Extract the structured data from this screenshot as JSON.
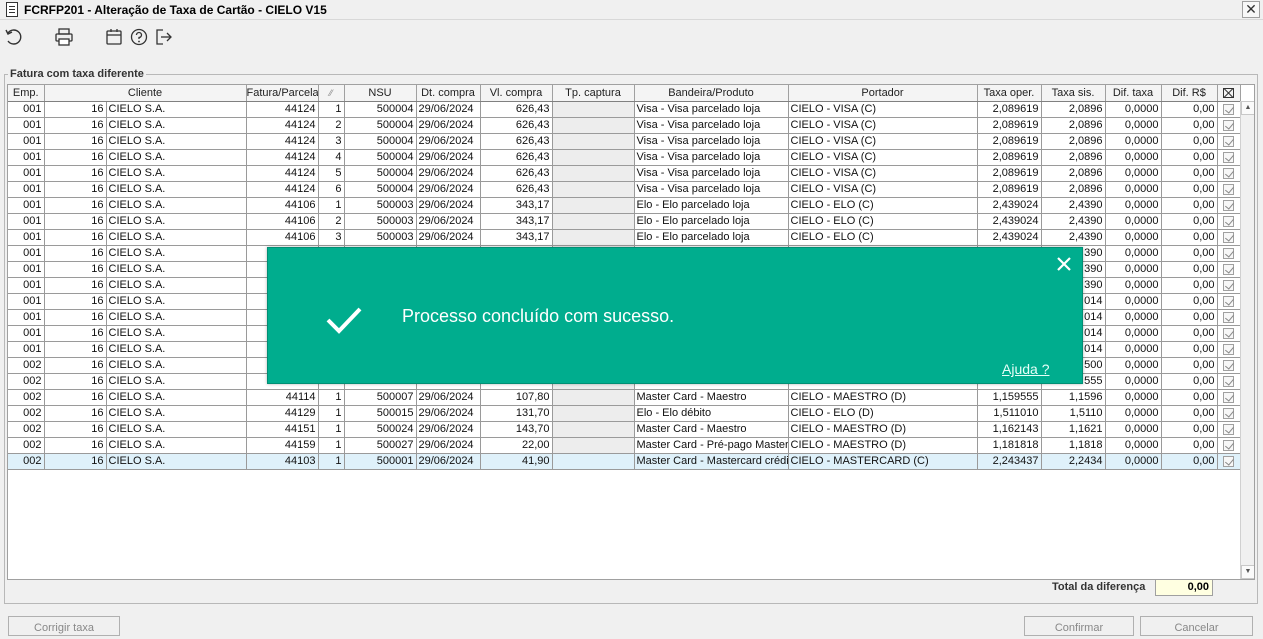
{
  "window": {
    "title": "FCRFP201 - Alteração de Taxa de Cartão - CIELO V15"
  },
  "toolbar": {
    "icons": [
      "refresh-icon",
      "printer-icon",
      "calendar-icon",
      "help-icon",
      "exit-icon"
    ]
  },
  "section": {
    "legend": "Fatura com taxa diferente"
  },
  "grid": {
    "columns": [
      "Emp.",
      "Cliente",
      "",
      "Fatura/Parcela",
      "",
      "NSU",
      "Dt. compra",
      "Vl. compra",
      "Tp. captura",
      "Bandeira/Produto",
      "Portador",
      "Taxa oper.",
      "Taxa sis.",
      "Dif. taxa",
      "Dif. R$",
      ""
    ],
    "rows": [
      {
        "emp": "001",
        "cod": "16",
        "cliente": "CIELO S.A.",
        "fatura": "44124",
        "parc": "1",
        "nsu": "500004",
        "dt": "29/06/2024",
        "vl": "626,43",
        "tp": "",
        "band": "Visa - Visa parcelado loja",
        "port": "CIELO - VISA (C)",
        "toper": "2,089619",
        "tsis": "2,0896",
        "dtaxa": "0,0000",
        "drs": "0,00"
      },
      {
        "emp": "001",
        "cod": "16",
        "cliente": "CIELO S.A.",
        "fatura": "44124",
        "parc": "2",
        "nsu": "500004",
        "dt": "29/06/2024",
        "vl": "626,43",
        "tp": "",
        "band": "Visa - Visa parcelado loja",
        "port": "CIELO - VISA (C)",
        "toper": "2,089619",
        "tsis": "2,0896",
        "dtaxa": "0,0000",
        "drs": "0,00"
      },
      {
        "emp": "001",
        "cod": "16",
        "cliente": "CIELO S.A.",
        "fatura": "44124",
        "parc": "3",
        "nsu": "500004",
        "dt": "29/06/2024",
        "vl": "626,43",
        "tp": "",
        "band": "Visa - Visa parcelado loja",
        "port": "CIELO - VISA (C)",
        "toper": "2,089619",
        "tsis": "2,0896",
        "dtaxa": "0,0000",
        "drs": "0,00"
      },
      {
        "emp": "001",
        "cod": "16",
        "cliente": "CIELO S.A.",
        "fatura": "44124",
        "parc": "4",
        "nsu": "500004",
        "dt": "29/06/2024",
        "vl": "626,43",
        "tp": "",
        "band": "Visa - Visa parcelado loja",
        "port": "CIELO - VISA (C)",
        "toper": "2,089619",
        "tsis": "2,0896",
        "dtaxa": "0,0000",
        "drs": "0,00"
      },
      {
        "emp": "001",
        "cod": "16",
        "cliente": "CIELO S.A.",
        "fatura": "44124",
        "parc": "5",
        "nsu": "500004",
        "dt": "29/06/2024",
        "vl": "626,43",
        "tp": "",
        "band": "Visa - Visa parcelado loja",
        "port": "CIELO - VISA (C)",
        "toper": "2,089619",
        "tsis": "2,0896",
        "dtaxa": "0,0000",
        "drs": "0,00"
      },
      {
        "emp": "001",
        "cod": "16",
        "cliente": "CIELO S.A.",
        "fatura": "44124",
        "parc": "6",
        "nsu": "500004",
        "dt": "29/06/2024",
        "vl": "626,43",
        "tp": "",
        "band": "Visa - Visa parcelado loja",
        "port": "CIELO - VISA (C)",
        "toper": "2,089619",
        "tsis": "2,0896",
        "dtaxa": "0,0000",
        "drs": "0,00"
      },
      {
        "emp": "001",
        "cod": "16",
        "cliente": "CIELO S.A.",
        "fatura": "44106",
        "parc": "1",
        "nsu": "500003",
        "dt": "29/06/2024",
        "vl": "343,17",
        "tp": "",
        "band": "Elo - Elo parcelado loja",
        "port": "CIELO - ELO (C)",
        "toper": "2,439024",
        "tsis": "2,4390",
        "dtaxa": "0,0000",
        "drs": "0,00"
      },
      {
        "emp": "001",
        "cod": "16",
        "cliente": "CIELO S.A.",
        "fatura": "44106",
        "parc": "2",
        "nsu": "500003",
        "dt": "29/06/2024",
        "vl": "343,17",
        "tp": "",
        "band": "Elo - Elo parcelado loja",
        "port": "CIELO - ELO (C)",
        "toper": "2,439024",
        "tsis": "2,4390",
        "dtaxa": "0,0000",
        "drs": "0,00"
      },
      {
        "emp": "001",
        "cod": "16",
        "cliente": "CIELO S.A.",
        "fatura": "44106",
        "parc": "3",
        "nsu": "500003",
        "dt": "29/06/2024",
        "vl": "343,17",
        "tp": "",
        "band": "Elo - Elo parcelado loja",
        "port": "CIELO - ELO (C)",
        "toper": "2,439024",
        "tsis": "2,4390",
        "dtaxa": "0,0000",
        "drs": "0,00"
      },
      {
        "emp": "001",
        "cod": "16",
        "cliente": "CIELO S.A.",
        "fatura": "",
        "parc": "",
        "nsu": "",
        "dt": "",
        "vl": "",
        "tp": "",
        "band": "",
        "port": "",
        "toper": "",
        "tsis": "390",
        "dtaxa": "0,0000",
        "drs": "0,00"
      },
      {
        "emp": "001",
        "cod": "16",
        "cliente": "CIELO S.A.",
        "fatura": "",
        "parc": "",
        "nsu": "",
        "dt": "",
        "vl": "",
        "tp": "",
        "band": "",
        "port": "",
        "toper": "",
        "tsis": "390",
        "dtaxa": "0,0000",
        "drs": "0,00"
      },
      {
        "emp": "001",
        "cod": "16",
        "cliente": "CIELO S.A.",
        "fatura": "",
        "parc": "",
        "nsu": "",
        "dt": "",
        "vl": "",
        "tp": "",
        "band": "",
        "port": "",
        "toper": "",
        "tsis": "390",
        "dtaxa": "0,0000",
        "drs": "0,00"
      },
      {
        "emp": "001",
        "cod": "16",
        "cliente": "CIELO S.A.",
        "fatura": "",
        "parc": "",
        "nsu": "",
        "dt": "",
        "vl": "",
        "tp": "",
        "band": "",
        "port": "",
        "toper": "",
        "tsis": "014",
        "dtaxa": "0,0000",
        "drs": "0,00"
      },
      {
        "emp": "001",
        "cod": "16",
        "cliente": "CIELO S.A.",
        "fatura": "",
        "parc": "",
        "nsu": "",
        "dt": "",
        "vl": "",
        "tp": "",
        "band": "",
        "port": "",
        "toper": "",
        "tsis": "014",
        "dtaxa": "0,0000",
        "drs": "0,00"
      },
      {
        "emp": "001",
        "cod": "16",
        "cliente": "CIELO S.A.",
        "fatura": "",
        "parc": "",
        "nsu": "",
        "dt": "",
        "vl": "",
        "tp": "",
        "band": "",
        "port": "",
        "toper": "",
        "tsis": "014",
        "dtaxa": "0,0000",
        "drs": "0,00"
      },
      {
        "emp": "001",
        "cod": "16",
        "cliente": "CIELO S.A.",
        "fatura": "",
        "parc": "",
        "nsu": "",
        "dt": "",
        "vl": "",
        "tp": "",
        "band": "",
        "port": "",
        "toper": "",
        "tsis": "014",
        "dtaxa": "0,0000",
        "drs": "0,00"
      },
      {
        "emp": "002",
        "cod": "16",
        "cliente": "CIELO S.A.",
        "fatura": "",
        "parc": "",
        "nsu": "",
        "dt": "",
        "vl": "",
        "tp": "",
        "band": "",
        "port": "",
        "toper": "",
        "tsis": "500",
        "dtaxa": "0,0000",
        "drs": "0,00"
      },
      {
        "emp": "002",
        "cod": "16",
        "cliente": "CIELO S.A.",
        "fatura": "",
        "parc": "",
        "nsu": "",
        "dt": "",
        "vl": "",
        "tp": "",
        "band": "",
        "port": "",
        "toper": "",
        "tsis": "555",
        "dtaxa": "0,0000",
        "drs": "0,00"
      },
      {
        "emp": "002",
        "cod": "16",
        "cliente": "CIELO S.A.",
        "fatura": "44114",
        "parc": "1",
        "nsu": "500007",
        "dt": "29/06/2024",
        "vl": "107,80",
        "tp": "",
        "band": "Master Card - Maestro",
        "port": "CIELO - MAESTRO (D)",
        "toper": "1,159555",
        "tsis": "1,1596",
        "dtaxa": "0,0000",
        "drs": "0,00"
      },
      {
        "emp": "002",
        "cod": "16",
        "cliente": "CIELO S.A.",
        "fatura": "44129",
        "parc": "1",
        "nsu": "500015",
        "dt": "29/06/2024",
        "vl": "131,70",
        "tp": "",
        "band": "Elo - Elo débito",
        "port": "CIELO - ELO (D)",
        "toper": "1,511010",
        "tsis": "1,5110",
        "dtaxa": "0,0000",
        "drs": "0,00"
      },
      {
        "emp": "002",
        "cod": "16",
        "cliente": "CIELO S.A.",
        "fatura": "44151",
        "parc": "1",
        "nsu": "500024",
        "dt": "29/06/2024",
        "vl": "143,70",
        "tp": "",
        "band": "Master Card - Maestro",
        "port": "CIELO - MAESTRO (D)",
        "toper": "1,162143",
        "tsis": "1,1621",
        "dtaxa": "0,0000",
        "drs": "0,00"
      },
      {
        "emp": "002",
        "cod": "16",
        "cliente": "CIELO S.A.",
        "fatura": "44159",
        "parc": "1",
        "nsu": "500027",
        "dt": "29/06/2024",
        "vl": "22,00",
        "tp": "",
        "band": "Master Card - Pré-pago Master",
        "port": "CIELO - MAESTRO (D)",
        "toper": "1,181818",
        "tsis": "1,1818",
        "dtaxa": "0,0000",
        "drs": "0,00"
      },
      {
        "emp": "002",
        "cod": "16",
        "cliente": "CIELO S.A.",
        "fatura": "44103",
        "parc": "1",
        "nsu": "500001",
        "dt": "29/06/2024",
        "vl": "41,90",
        "tp": "",
        "band": "Master Card - Mastercard crédi",
        "port": "CIELO - MASTERCARD (C)",
        "toper": "2,243437",
        "tsis": "2,2434",
        "dtaxa": "0,0000",
        "drs": "0,00",
        "selected": true
      }
    ]
  },
  "footer": {
    "total_label": "Total da diferença",
    "total_value": "0,00"
  },
  "buttons": {
    "fix_rate": "Corrigir taxa",
    "confirm": "Confirmar",
    "cancel": "Cancelar"
  },
  "toast": {
    "message": "Processo concluído com sucesso.",
    "help_link": "Ajuda ?",
    "color": "#00ad8e"
  }
}
